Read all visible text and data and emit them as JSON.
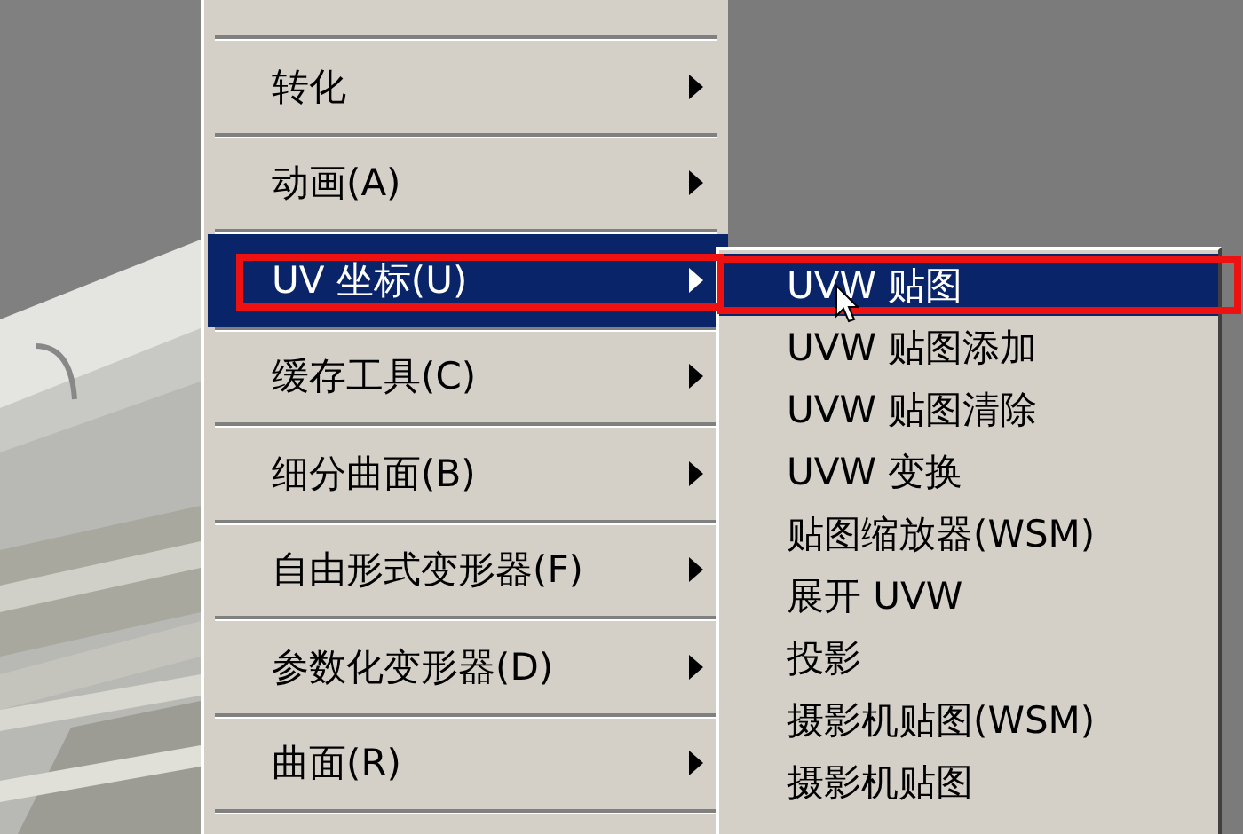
{
  "menu": {
    "items": [
      {
        "label": "转化",
        "selected": false,
        "has_submenu": true
      },
      {
        "label": "动画(A)",
        "selected": false,
        "has_submenu": true
      },
      {
        "label": "UV 坐标(U)",
        "selected": true,
        "has_submenu": true
      },
      {
        "label": "缓存工具(C)",
        "selected": false,
        "has_submenu": true
      },
      {
        "label": "细分曲面(B)",
        "selected": false,
        "has_submenu": true
      },
      {
        "label": "自由形式变形器(F)",
        "selected": false,
        "has_submenu": true
      },
      {
        "label": "参数化变形器(D)",
        "selected": false,
        "has_submenu": true
      },
      {
        "label": "曲面(R)",
        "selected": false,
        "has_submenu": true
      }
    ]
  },
  "submenu": {
    "items": [
      {
        "label": "UVW 贴图",
        "selected": true
      },
      {
        "label": "UVW 贴图添加",
        "selected": false
      },
      {
        "label": "UVW 贴图清除",
        "selected": false
      },
      {
        "label": "UVW 变换",
        "selected": false
      },
      {
        "label": "贴图缩放器(WSM)",
        "selected": false
      },
      {
        "label": "展开 UVW",
        "selected": false
      },
      {
        "label": "投影",
        "selected": false
      },
      {
        "label": "摄影机贴图(WSM)",
        "selected": false
      },
      {
        "label": "摄影机贴图",
        "selected": false
      }
    ]
  }
}
